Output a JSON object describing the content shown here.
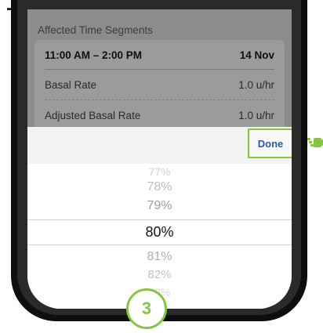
{
  "segments": {
    "title": "Affected Time Segments",
    "rows": [
      {
        "label": "11:00 AM – 2:00 PM",
        "value": "14 Nov"
      },
      {
        "label": "Basal Rate",
        "value": "1.0 u/hr"
      },
      {
        "label": "Adjusted Basal Rate",
        "value": "1.0 u/hr"
      }
    ]
  },
  "toolbar": {
    "done_label": "Done"
  },
  "picker": {
    "options": [
      "77%",
      "78%",
      "79%",
      "80%",
      "81%",
      "82%",
      "83%"
    ],
    "selected": "80%"
  },
  "step_badge": "3",
  "colors": {
    "accent_green": "#86c543",
    "done_blue": "#2b5ca8",
    "header_rule": "#16324a"
  },
  "icons": {
    "pointer": "hand-pointer-icon"
  }
}
